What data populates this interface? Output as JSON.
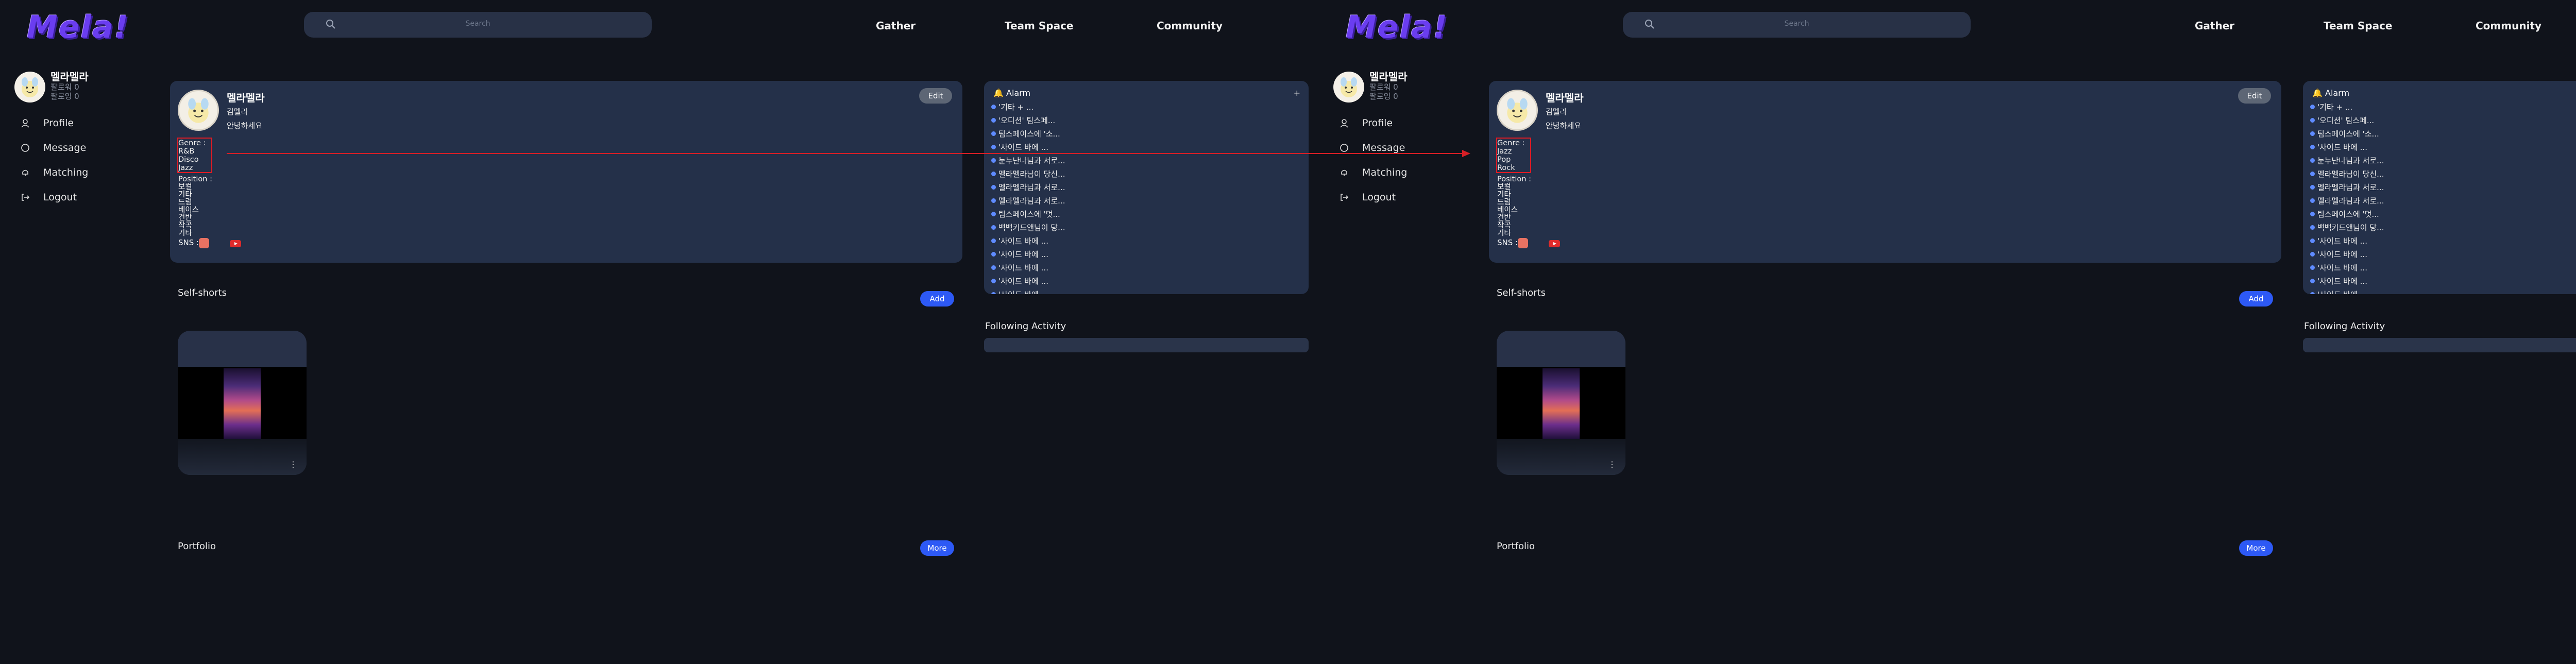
{
  "header": {
    "logo": "Mela!",
    "search_placeholder": "Search",
    "nav": [
      "Gather",
      "Team Space",
      "Community"
    ]
  },
  "sidebar": {
    "name": "멜라멜라",
    "sub1": "팔로워 0",
    "sub2": "팔로잉 0",
    "items": [
      {
        "label": "Profile",
        "icon": "user-icon"
      },
      {
        "label": "Message",
        "icon": "message-icon"
      },
      {
        "label": "Matching",
        "icon": "matching-icon"
      },
      {
        "label": "Logout",
        "icon": "logout-icon"
      }
    ]
  },
  "profile": {
    "name": "멜라멜라",
    "realname": "김멜라",
    "bio": "안녕하세요",
    "edit": "Edit",
    "genre_label": "Genre :",
    "position_label": "Position :",
    "positions": [
      "보컬",
      "기타",
      "드럼",
      "베이스",
      "건반",
      "작곡",
      "기타"
    ],
    "sns_label": "SNS :"
  },
  "panels": [
    {
      "genres": [
        "R&B",
        "Disco",
        "Jazz"
      ]
    },
    {
      "genres": [
        "Jazz",
        "Pop",
        "Rock"
      ]
    }
  ],
  "alarm": {
    "title": "Alarm",
    "plus": "+",
    "items": [
      "'기타 + ...",
      "'오디션' 팀스페...",
      "팀스페이스에 '소...",
      "'사이드 바에 ...",
      "눈누난나님과 서로...",
      "멜라멜라님이 당신...",
      "멜라멜라님과 서로...",
      "멜라멜라님과 서로...",
      "팀스페이스에 '멋...",
      "백백키드앤님이 당...",
      "'사이드 바에 ...",
      "'사이드 바에 ...",
      "'사이드 바에 ...",
      "'사이드 바에 ...",
      "'사이드 바에 ..."
    ]
  },
  "sections": {
    "self_shorts": "Self-shorts",
    "add": "Add",
    "following": "Following Activity",
    "portfolio": "Portfolio",
    "more": "More",
    "short_more": "⋮"
  },
  "colors": {
    "background": "#10131b",
    "card": "#243049",
    "accent": "#2d59f5",
    "annotation": "#d61f26",
    "logo": "#6a3df0"
  }
}
